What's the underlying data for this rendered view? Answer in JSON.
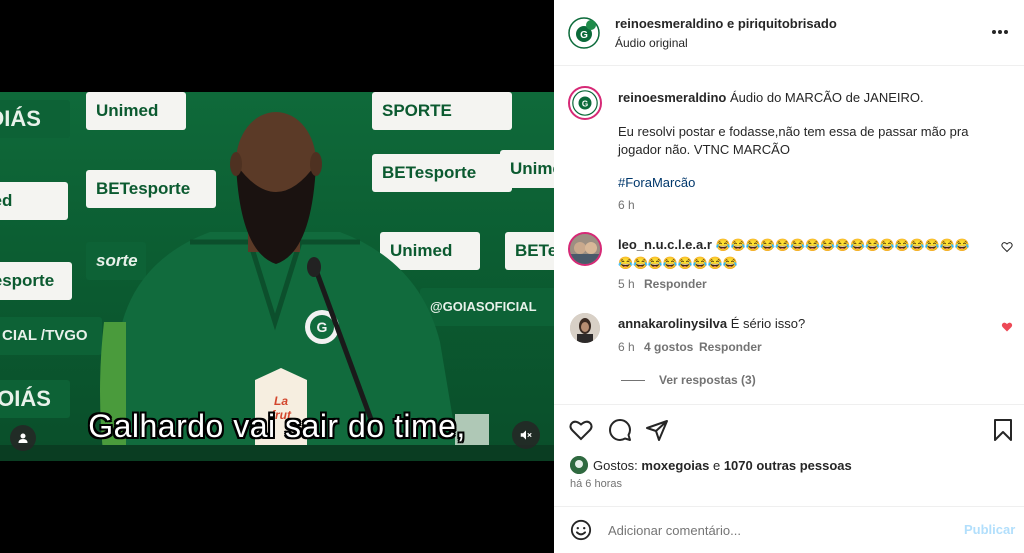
{
  "video": {
    "subtitle": "Galhardo vai sair do time,",
    "sponsors": {
      "unimed": "Unimed",
      "bet": "BETesporte",
      "goias": "GOIÁS",
      "social": "@GOIASOFICIAL",
      "sparte": "SPORTE",
      "cial": "CIAL",
      "tvgo": "/TVGO",
      "sorte": "sorte"
    },
    "drink_label": "La frut",
    "icons": [
      "user-icon",
      "mute-icon"
    ]
  },
  "post": {
    "header": {
      "username": "reinoesmeraldino e piriquitobrisado",
      "audio": "Áudio original"
    },
    "caption": {
      "username": "reinoesmeraldino",
      "text_line1": "Áudio do MARCÃO de JANEIRO.",
      "text_line2": "Eu resolvi postar e fodasse,não tem essa de passar mão pra jogador não. VTNC MARCÃO",
      "hashtag": "#ForaMarcão",
      "time": "6 h"
    },
    "comments": [
      {
        "username": "leo_n.u.c.l.e.a.r",
        "emojis_line1": "😂😂😂😂😂😂😂😂😂😂😂😂😂😂😂😂😂",
        "emojis_line2": "😂😂😂😂😂😂😂😂",
        "time": "5 h",
        "reply": "Responder"
      },
      {
        "username": "annakarolinysilva",
        "text": "É sério isso?",
        "time": "6 h",
        "likes": "4 gostos",
        "reply": "Responder",
        "view_replies": "Ver respostas (3)"
      }
    ],
    "likes": {
      "prefix": "Gostos:",
      "user": "moxegoias",
      "rest": "e",
      "others": "1070 outras pessoas"
    },
    "timestamp": "há 6 horas",
    "add_comment": {
      "placeholder": "Adicionar comentário...",
      "publish": "Publicar"
    },
    "colors": {
      "like_red": "#ed4956",
      "publish_blue": "#b2dffc",
      "hashtag": "#00376b"
    }
  }
}
